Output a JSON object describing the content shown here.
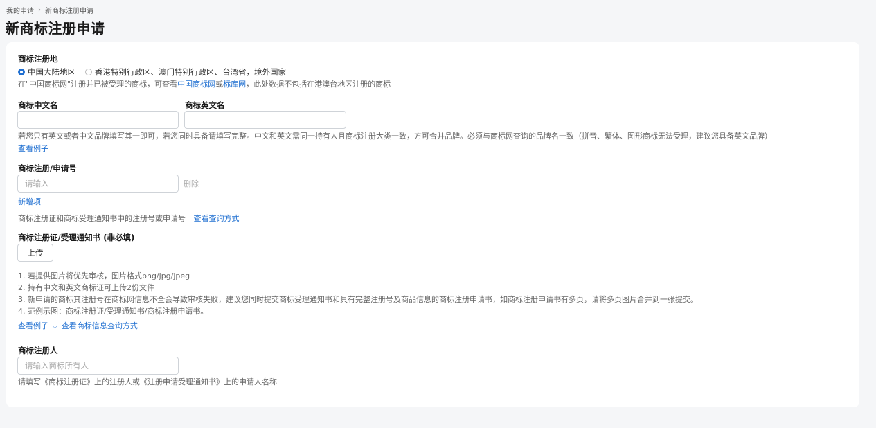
{
  "breadcrumb": {
    "parent": "我的申请",
    "current": "新商标注册申请"
  },
  "page_title": "新商标注册申请",
  "region": {
    "label": "商标注册地",
    "options": [
      {
        "label": "中国大陆地区",
        "selected": true
      },
      {
        "label": "香港特别行政区、澳门特别行政区、台湾省，境外国家",
        "selected": false
      }
    ],
    "hint_prefix": "在\"中国商标网\"注册并已被受理的商标，可查看",
    "hint_link1": "中国商标网",
    "hint_or": "或",
    "hint_link2": "标库网",
    "hint_suffix": "，此处数据不包括在港澳台地区注册的商标"
  },
  "names": {
    "cn_label": "商标中文名",
    "en_label": "商标英文名",
    "cn_value": "",
    "en_value": "",
    "hint": "若您只有英文或者中文品牌填写其一即可，若您同时具备请填写完整。中文和英文需同一持有人且商标注册大类一致，方可合并品牌。必须与商标网查询的品牌名一致（拼音、繁体、图形商标无法受理，建议您具备英文品牌）",
    "example_link": "查看例子"
  },
  "reg_number": {
    "label": "商标注册/申请号",
    "placeholder": "请输入",
    "delete_label": "删除",
    "add_link": "新增项",
    "hint": "商标注册证和商标受理通知书中的注册号或申请号",
    "query_link": "查看查询方式"
  },
  "certificate": {
    "label": "商标注册证/受理通知书 (非必填)",
    "upload_label": "上传",
    "notes": [
      "1. 若提供图片将优先审核，图片格式png/jpg/jpeg",
      "2. 持有中文和英文商标证可上传2份文件",
      "3. 新申请的商标其注册号在商标网信息不全会导致审核失败，建议您同时提交商标受理通知书和具有完整注册号及商品信息的商标注册申请书，如商标注册申请书有多页，请将多页图片合并到一张提交。",
      "4. 范例示图：商标注册证/受理通知书/商标注册申请书。"
    ],
    "example_link": "查看例子",
    "query_link": "查看商标信息查询方式"
  },
  "registrant": {
    "label": "商标注册人",
    "placeholder": "请输入商标所有人",
    "hint": "请填写《商标注册证》上的注册人或《注册申请受理通知书》上的申请人名称"
  },
  "colors": {
    "accent": "#1f6fd1",
    "background": "#f5f6f8",
    "card": "#ffffff"
  }
}
